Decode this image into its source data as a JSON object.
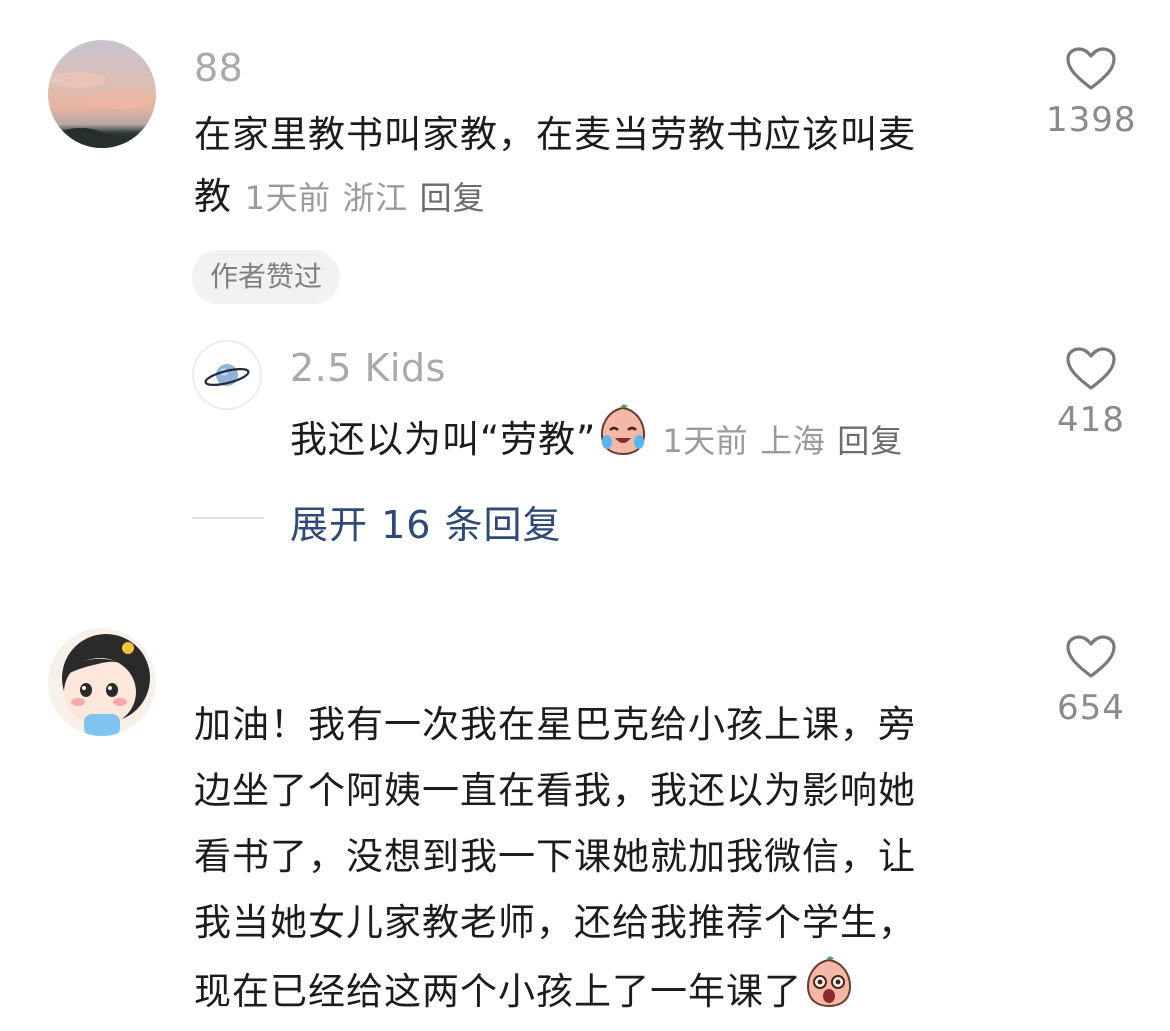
{
  "comments": [
    {
      "username": "88",
      "text_line1": "在家里教书叫家教，在麦当劳教书应该叫麦",
      "text_line2": "教",
      "time": "1天前",
      "location": "浙江",
      "reply_label": "回复",
      "likes": "1398",
      "badge": "作者赞过",
      "replies": [
        {
          "username": "2.5 Kids",
          "text": "我还以为叫“劳教”",
          "emoji": "crying-laugh-emoji",
          "time": "1天前",
          "location": "上海",
          "reply_label": "回复",
          "likes": "418"
        }
      ],
      "expand_label": "展开 16 条回复"
    },
    {
      "username": "",
      "text_lines": [
        "加油！我有一次我在星巴克给小孩上课，旁",
        "边坐了个阿姨一直在看我，我还以为影响她",
        "看书了，没想到我一下课她就加我微信，让",
        "我当她女儿家教老师，还给我推荐个学生，",
        "现在已经给这两个小孩上了一年课了"
      ],
      "emoji": "surprised-emoji",
      "likes": "654"
    }
  ],
  "colors": {
    "meta": "#9a9a9a",
    "expand_link": "#2f4a78",
    "badge_bg": "#f2f2f2"
  }
}
